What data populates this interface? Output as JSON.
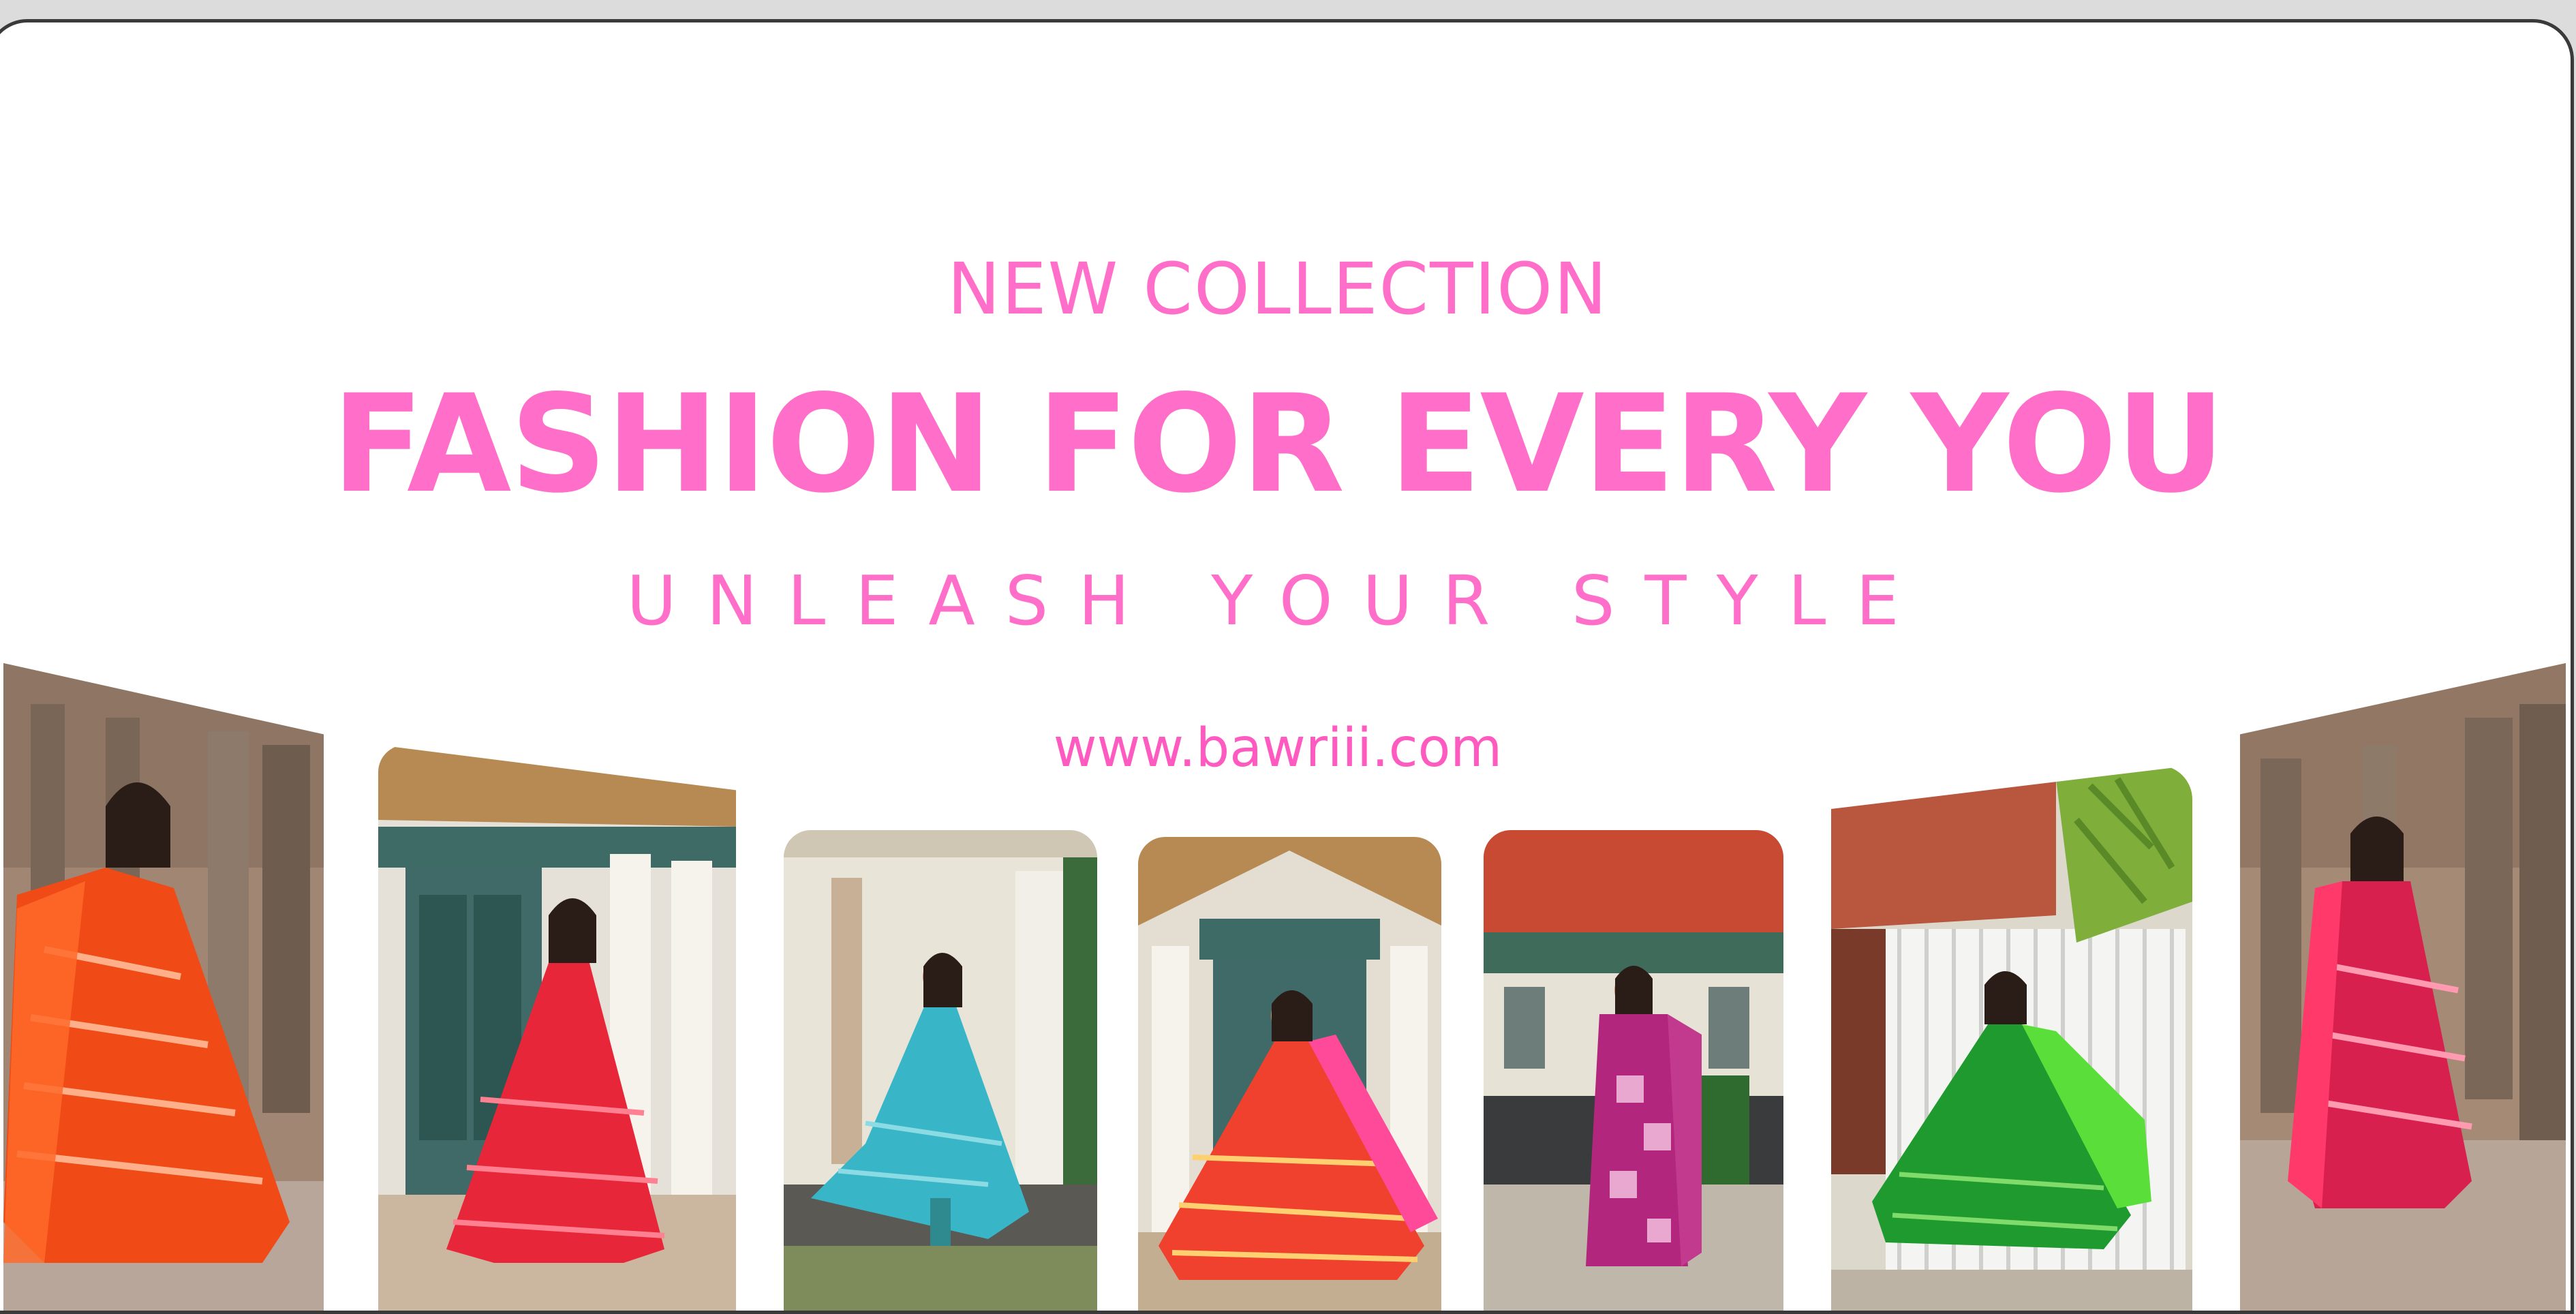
{
  "banner": {
    "eyebrow": "NEW COLLECTION",
    "title": "FASHION FOR EVERY YOU",
    "tagline": "UNLEASH YOUR STYLE",
    "website": "www.bawriii.com"
  },
  "colors": {
    "accent_pink": "#ff6fc9",
    "background": "#ffffff"
  },
  "photos": [
    {
      "name": "orange-leheriya-anarkali-photo",
      "dress_color": "#f04a16"
    },
    {
      "name": "red-anarkali-photo",
      "dress_color": "#e8263a"
    },
    {
      "name": "turquoise-anarkali-photo",
      "dress_color": "#38b6c8"
    },
    {
      "name": "red-orange-leheriya-anarkali-photo",
      "dress_color": "#f0402e"
    },
    {
      "name": "magenta-printed-suit-photo",
      "dress_color": "#b3267e"
    },
    {
      "name": "green-anarkali-photo",
      "dress_color": "#1f9a2e"
    },
    {
      "name": "pink-leheriya-anarkali-photo",
      "dress_color": "#d8204e"
    }
  ]
}
